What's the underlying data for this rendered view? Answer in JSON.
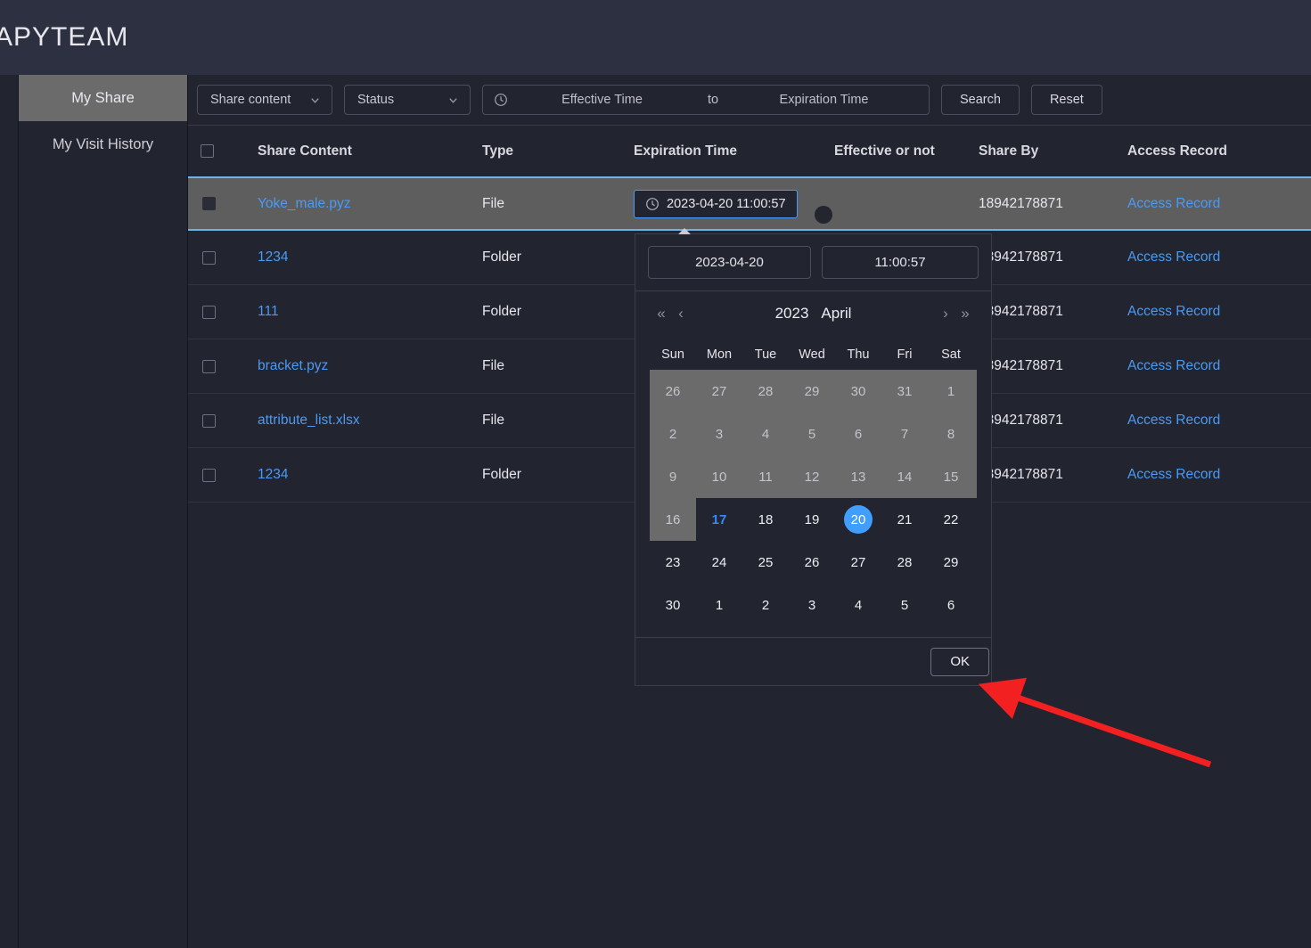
{
  "header": {
    "title": "APYTEAM"
  },
  "sidebar": {
    "items": [
      {
        "label": "My Share",
        "active": true
      },
      {
        "label": "My Visit History",
        "active": false
      }
    ]
  },
  "toolbar": {
    "share_content_select": "Share content",
    "status_select": "Status",
    "effective_time_placeholder": "Effective Time",
    "range_separator": "to",
    "expiration_time_placeholder": "Expiration Time",
    "search_label": "Search",
    "reset_label": "Reset",
    "clock_icon": "clock-icon",
    "chevron_icon": "chevron-down-icon"
  },
  "table": {
    "columns": [
      "Share Content",
      "Type",
      "Expiration Time",
      "Effective or not",
      "Share By",
      "Access Record"
    ],
    "access_record_label": "Access Record",
    "rows": [
      {
        "name": "Yoke_male.pyz",
        "type": "File",
        "expiration": "2023-04-20 11:00:57",
        "effective": true,
        "share_by": "18942178871",
        "selected": true,
        "checked": true
      },
      {
        "name": "1234",
        "type": "Folder",
        "expiration": "",
        "effective": true,
        "share_by": "18942178871",
        "selected": false,
        "checked": false
      },
      {
        "name": "111",
        "type": "Folder",
        "expiration": "",
        "effective": true,
        "share_by": "18942178871",
        "selected": false,
        "checked": false
      },
      {
        "name": "bracket.pyz",
        "type": "File",
        "expiration": "",
        "effective": true,
        "share_by": "18942178871",
        "selected": false,
        "checked": false
      },
      {
        "name": "attribute_list.xlsx",
        "type": "File",
        "expiration": "",
        "effective": true,
        "share_by": "18942178871",
        "selected": false,
        "checked": false
      },
      {
        "name": "1234",
        "type": "Folder",
        "expiration": "",
        "effective": true,
        "share_by": "18942178871",
        "selected": false,
        "checked": false
      }
    ]
  },
  "date_picker": {
    "date_value": "2023-04-20",
    "time_value": "11:00:57",
    "year": "2023",
    "month": "April",
    "nav": {
      "prev_year": "«",
      "prev_month": "‹",
      "next_month": "›",
      "next_year": "»"
    },
    "weekdays": [
      "Sun",
      "Mon",
      "Tue",
      "Wed",
      "Thu",
      "Fri",
      "Sat"
    ],
    "weeks": [
      {
        "disabled": true,
        "days": [
          {
            "d": "26",
            "off": true
          },
          {
            "d": "27",
            "off": true
          },
          {
            "d": "28",
            "off": true
          },
          {
            "d": "29",
            "off": true
          },
          {
            "d": "30",
            "off": true
          },
          {
            "d": "31",
            "off": true
          },
          {
            "d": "1",
            "off": true
          }
        ]
      },
      {
        "disabled": true,
        "days": [
          {
            "d": "2",
            "off": true
          },
          {
            "d": "3",
            "off": true
          },
          {
            "d": "4",
            "off": true
          },
          {
            "d": "5",
            "off": true
          },
          {
            "d": "6",
            "off": true
          },
          {
            "d": "7",
            "off": true
          },
          {
            "d": "8",
            "off": true
          }
        ]
      },
      {
        "disabled": true,
        "days": [
          {
            "d": "9",
            "off": true
          },
          {
            "d": "10",
            "off": true
          },
          {
            "d": "11",
            "off": true
          },
          {
            "d": "12",
            "off": true
          },
          {
            "d": "13",
            "off": true
          },
          {
            "d": "14",
            "off": true
          },
          {
            "d": "15",
            "off": true
          }
        ]
      },
      {
        "disabled": false,
        "days": [
          {
            "d": "16",
            "dim": true
          },
          {
            "d": "17",
            "today": true
          },
          {
            "d": "18"
          },
          {
            "d": "19"
          },
          {
            "d": "20",
            "selected": true
          },
          {
            "d": "21"
          },
          {
            "d": "22"
          }
        ]
      },
      {
        "disabled": false,
        "days": [
          {
            "d": "23"
          },
          {
            "d": "24"
          },
          {
            "d": "25"
          },
          {
            "d": "26"
          },
          {
            "d": "27"
          },
          {
            "d": "28"
          },
          {
            "d": "29"
          }
        ]
      },
      {
        "disabled": false,
        "days": [
          {
            "d": "30"
          },
          {
            "d": "1",
            "off": false
          },
          {
            "d": "2"
          },
          {
            "d": "3"
          },
          {
            "d": "4"
          },
          {
            "d": "5"
          },
          {
            "d": "6"
          }
        ]
      }
    ],
    "ok_label": "OK"
  },
  "colors": {
    "accent_blue": "#409eff",
    "link_blue": "#4a9bf5",
    "toggle_green": "#13ce66",
    "selected_row_bg": "#5e5e5e",
    "selected_row_border": "#6cb4e8",
    "panel_bg": "#22242f",
    "header_bg": "#2d3040",
    "annotation_red": "#f22020"
  }
}
